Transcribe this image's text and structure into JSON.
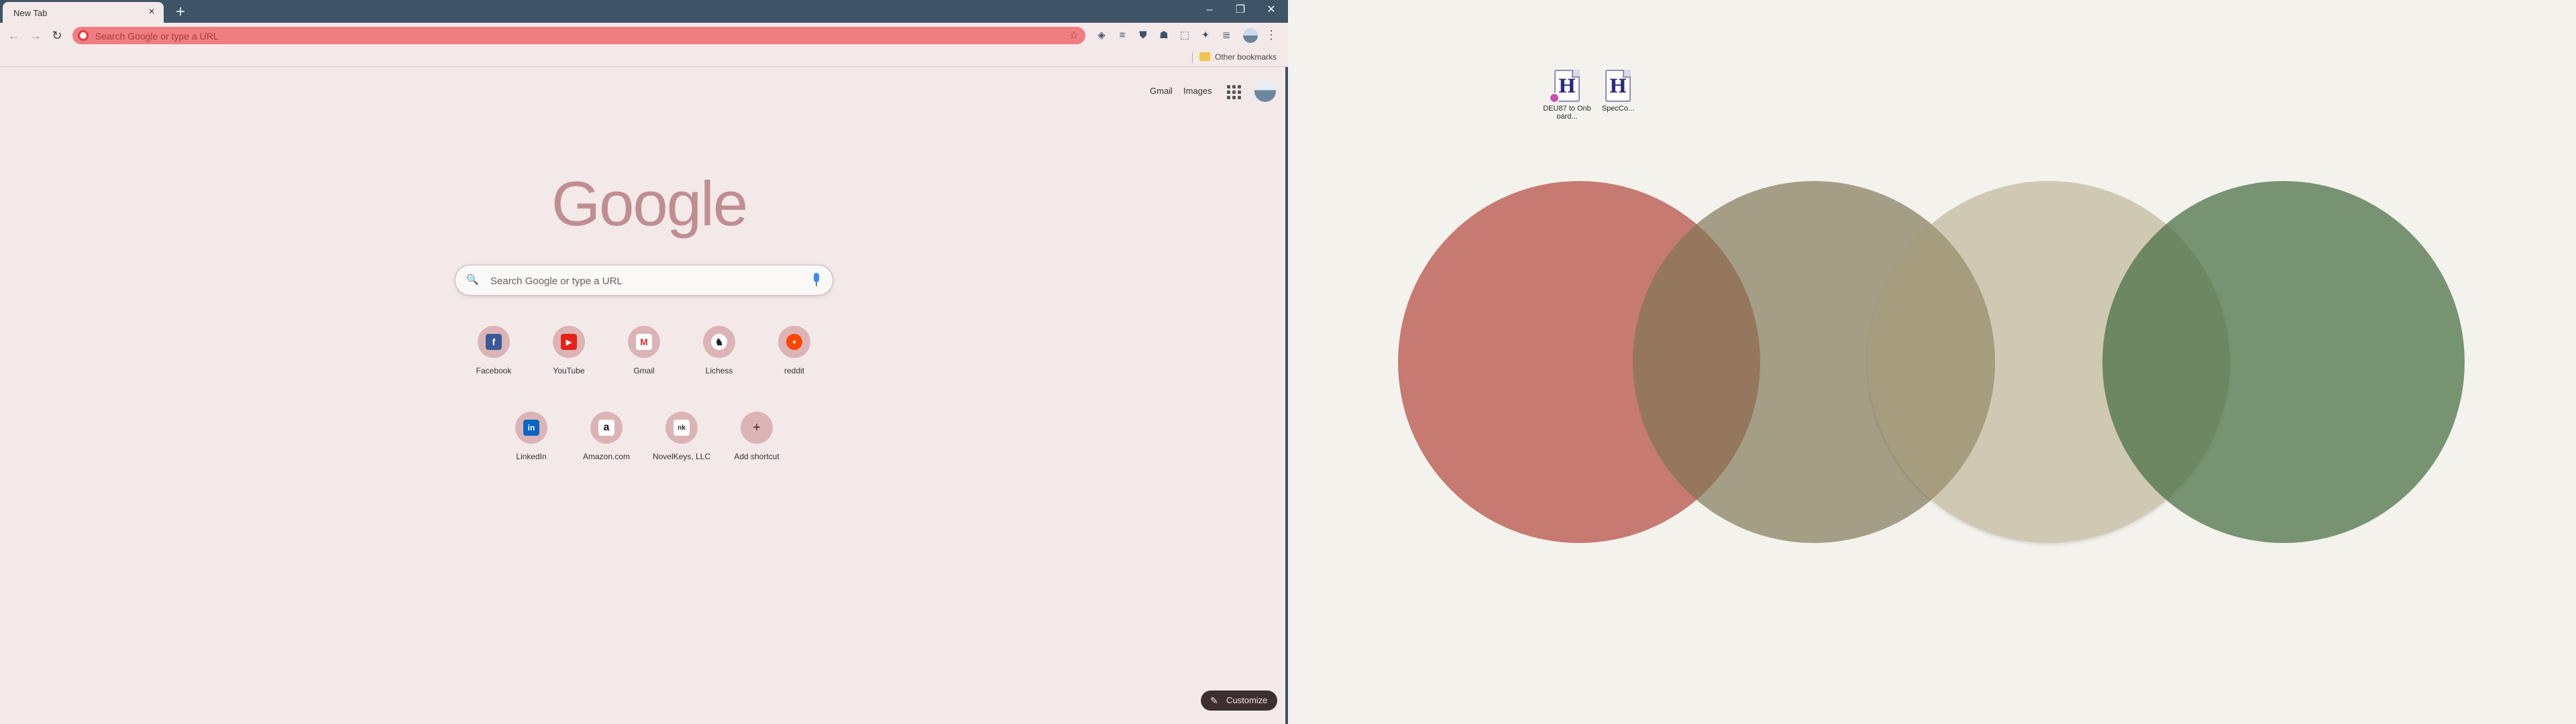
{
  "browser": {
    "tab": {
      "title": "New Tab",
      "close": "×"
    },
    "new_tab": "+",
    "window_controls": {
      "minimize": "–",
      "maximize": "❐",
      "close": "✕"
    },
    "nav": {
      "back": "←",
      "forward": "→",
      "reload": "↻"
    },
    "omnibox": {
      "placeholder": "Search Google or type a URL",
      "star": "☆"
    },
    "extensions": [
      "◈",
      "≡",
      "⛊",
      "☗",
      "⬚",
      "✦",
      "≣"
    ],
    "menu": "⋮",
    "bookmarks": {
      "other": "Other bookmarks"
    }
  },
  "ntp": {
    "links": {
      "gmail": "Gmail",
      "images": "Images"
    },
    "logo": {
      "letters": [
        "G",
        "o",
        "o",
        "g",
        "l",
        "e"
      ]
    },
    "search": {
      "icon": "🔍",
      "placeholder": "Search Google or type a URL"
    },
    "shortcuts": [
      {
        "label": "Facebook",
        "glyph": "f",
        "color": "#3b5998"
      },
      {
        "label": "YouTube",
        "glyph": "▶",
        "color": "#e62117"
      },
      {
        "label": "Gmail",
        "glyph": "M",
        "color": "#ffffff"
      },
      {
        "label": "Lichess",
        "glyph": "♞",
        "color": "#ffffff"
      },
      {
        "label": "reddit",
        "glyph": "●",
        "color": "#ff4500"
      },
      {
        "label": "LinkedIn",
        "glyph": "in",
        "color": "#0a66c2"
      },
      {
        "label": "Amazon.com",
        "glyph": "a",
        "color": "#ffffff"
      },
      {
        "label": "NovelKeys, LLC",
        "glyph": "nk",
        "color": "#ffffff"
      },
      {
        "label": "Add shortcut",
        "glyph": "+",
        "color": "#dcb4b5"
      }
    ],
    "customize": {
      "label": "Customize",
      "icon": "✎"
    }
  },
  "desktop": {
    "icons": [
      {
        "label": "DEU87 to Onboard...",
        "glyph": "H"
      },
      {
        "label": "SpecCo...",
        "glyph": "H"
      }
    ]
  },
  "colors": {
    "titlebar": "#3f5466",
    "page_bg": "#f3e9e9",
    "omnibox": "#f07d82",
    "circle_red": "#c87a72",
    "circle_olive": "#a49f86",
    "circle_tan": "#d2cab6",
    "circle_green": "#768e6e"
  }
}
